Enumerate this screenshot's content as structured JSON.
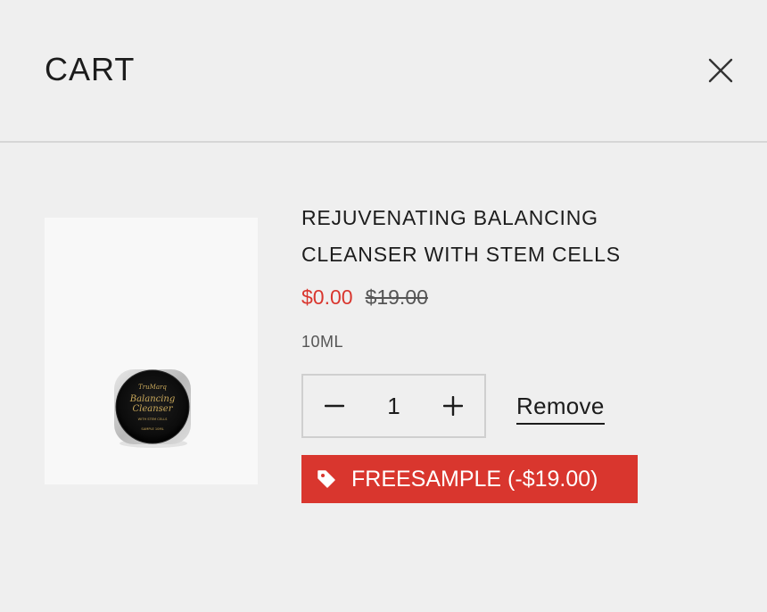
{
  "header": {
    "title": "CART",
    "close_icon": "close-icon"
  },
  "line_item": {
    "image_icon": "product-jar-image",
    "image_label": {
      "brand": "TruMarq",
      "name_line1": "Balancing",
      "name_line2": "Cleanser",
      "sub_line": "WITH STEM CELLS",
      "size_line": "SAMPLE 10ML"
    },
    "title": "REJUVENATING BALANCING CLEANSER WITH STEM CELLS",
    "price": "$0.00",
    "compare_price": "$19.00",
    "variant": "10ML",
    "quantity": "1",
    "minus_icon": "minus-icon",
    "plus_icon": "plus-icon",
    "remove_label": "Remove",
    "discount": {
      "icon": "tag-icon",
      "label": "FREESAMPLE (-$19.00)"
    }
  },
  "colors": {
    "background": "#efefef",
    "accent_red": "#d9362e",
    "text": "#1c1c1c",
    "border": "#cfcfcf"
  }
}
